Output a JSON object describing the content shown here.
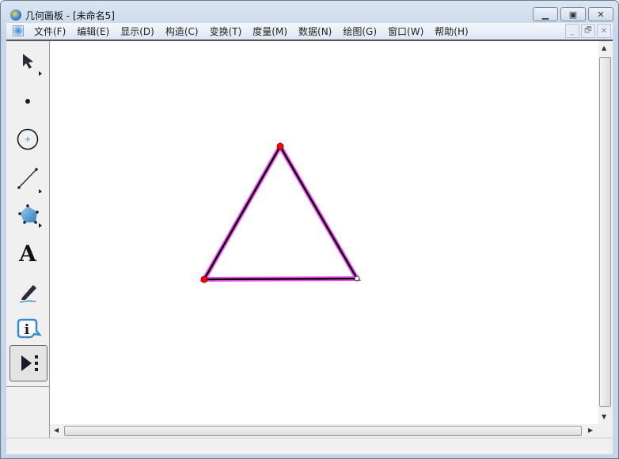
{
  "window": {
    "title": "几何画板 - [未命名5]"
  },
  "menu": [
    "文件(F)",
    "编辑(E)",
    "显示(D)",
    "构造(C)",
    "变换(T)",
    "度量(M)",
    "数据(N)",
    "绘图(G)",
    "窗口(W)",
    "帮助(H)"
  ],
  "tools": {
    "text_tool_glyph": "A",
    "info_tool_glyph": "i"
  },
  "sketch": {
    "points": [
      {
        "name": "top",
        "color": "#ff0000"
      },
      {
        "name": "left",
        "color": "#ff0000"
      },
      {
        "name": "right",
        "color": "#ffffff"
      }
    ],
    "segment_color": "#000000",
    "highlight_color": "#ff00ff"
  }
}
